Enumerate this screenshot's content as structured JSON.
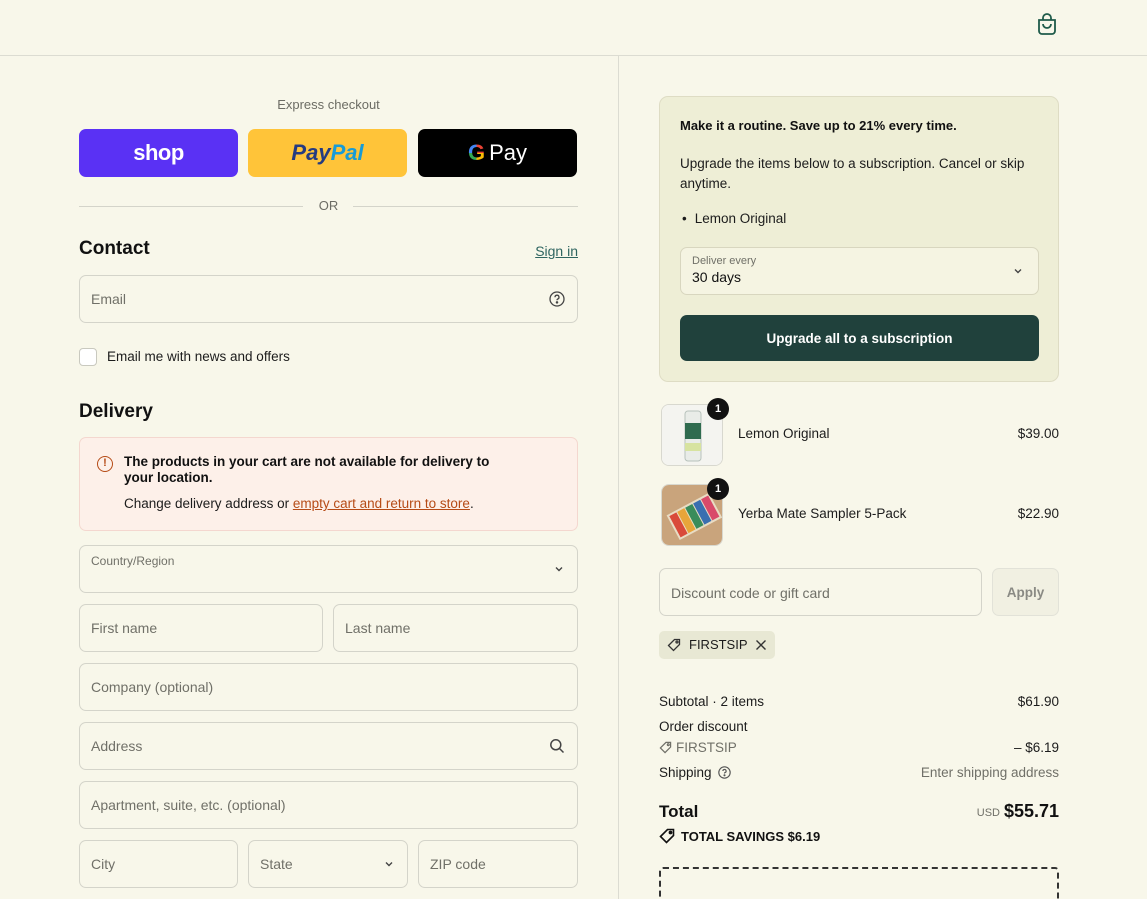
{
  "express_checkout": {
    "title": "Express checkout",
    "shop_label": "shop",
    "paypal_label_1": "Pay",
    "paypal_label_2": "Pal",
    "gpay_g": "G",
    "gpay_label": "Pay",
    "or_text": "OR"
  },
  "contact": {
    "heading": "Contact",
    "sign_in": "Sign in",
    "email_placeholder": "Email",
    "newsletter_label": "Email me with news and offers"
  },
  "delivery": {
    "heading": "Delivery",
    "alert_title": "The products in your cart are not available for delivery to your location.",
    "alert_body_prefix": "Change delivery address or ",
    "alert_link": "empty cart and return to store",
    "alert_body_suffix": ".",
    "country_label": "Country/Region",
    "first_name": "First name",
    "last_name": "Last name",
    "company": "Company (optional)",
    "address": "Address",
    "apartment": "Apartment, suite, etc. (optional)",
    "city": "City",
    "state": "State",
    "zip": "ZIP code"
  },
  "upsell": {
    "title": "Make it a routine. Save up to 21% every time.",
    "body": "Upgrade the items below to a subscription. Cancel or skip anytime.",
    "item": "Lemon Original",
    "deliver_label": "Deliver every",
    "deliver_value": "30 days",
    "button": "Upgrade all to a subscription"
  },
  "cart": {
    "items": [
      {
        "name": "Lemon Original",
        "price": "$39.00",
        "qty": "1"
      },
      {
        "name": "Yerba Mate Sampler 5-Pack",
        "price": "$22.90",
        "qty": "1"
      }
    ],
    "discount_placeholder": "Discount code or gift card",
    "apply": "Apply",
    "applied_code": "FIRSTSIP"
  },
  "summary": {
    "subtotal_label": "Subtotal · 2 items",
    "subtotal_value": "$61.90",
    "order_discount_label": "Order discount",
    "discount_code": "FIRSTSIP",
    "discount_value": "– $6.19",
    "shipping_label": "Shipping",
    "shipping_value": "Enter shipping address",
    "total_label": "Total",
    "currency": "USD",
    "total_value": "$55.71",
    "savings": "TOTAL SAVINGS  $6.19"
  },
  "colors": {
    "background": "#f8f7ea",
    "shop_purple": "#5a31f4",
    "paypal_yellow": "#ffc439",
    "primary_button": "#20413c",
    "alert_orange": "#b64b16"
  }
}
